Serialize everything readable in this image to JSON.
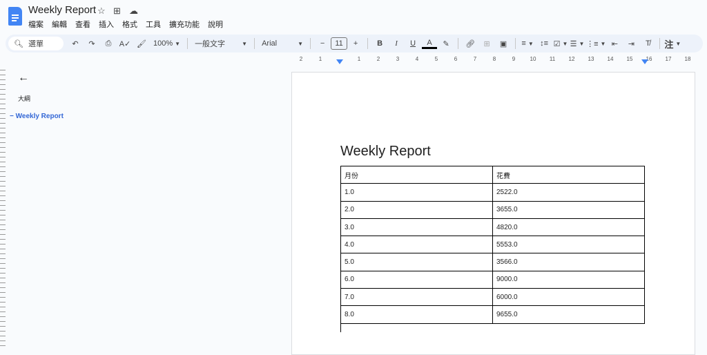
{
  "app": {
    "title": "Weekly Report",
    "menu": [
      "檔案",
      "編輯",
      "查看",
      "插入",
      "格式",
      "工具",
      "擴充功能",
      "說明"
    ]
  },
  "toolbar": {
    "search": "選單",
    "zoom": "100%",
    "style": "一般文字",
    "font": "Arial",
    "font_size": "11",
    "input_tools": "注"
  },
  "ruler": {
    "labels": [
      "2",
      "1",
      "1",
      "2",
      "3",
      "4",
      "5",
      "6",
      "7",
      "8",
      "9",
      "10",
      "11",
      "12",
      "13",
      "14",
      "15",
      "16",
      "17",
      "18"
    ]
  },
  "outline": {
    "heading": "大綱",
    "items": [
      "Weekly Report"
    ]
  },
  "document": {
    "title": "Weekly Report",
    "table": {
      "headers": [
        "月份",
        "花費"
      ],
      "rows": [
        [
          "1.0",
          "2522.0"
        ],
        [
          "2.0",
          "3655.0"
        ],
        [
          "3.0",
          "4820.0"
        ],
        [
          "4.0",
          "5553.0"
        ],
        [
          "5.0",
          "3566.0"
        ],
        [
          "6.0",
          "9000.0"
        ],
        [
          "7.0",
          "6000.0"
        ],
        [
          "8.0",
          "9655.0"
        ]
      ]
    }
  }
}
